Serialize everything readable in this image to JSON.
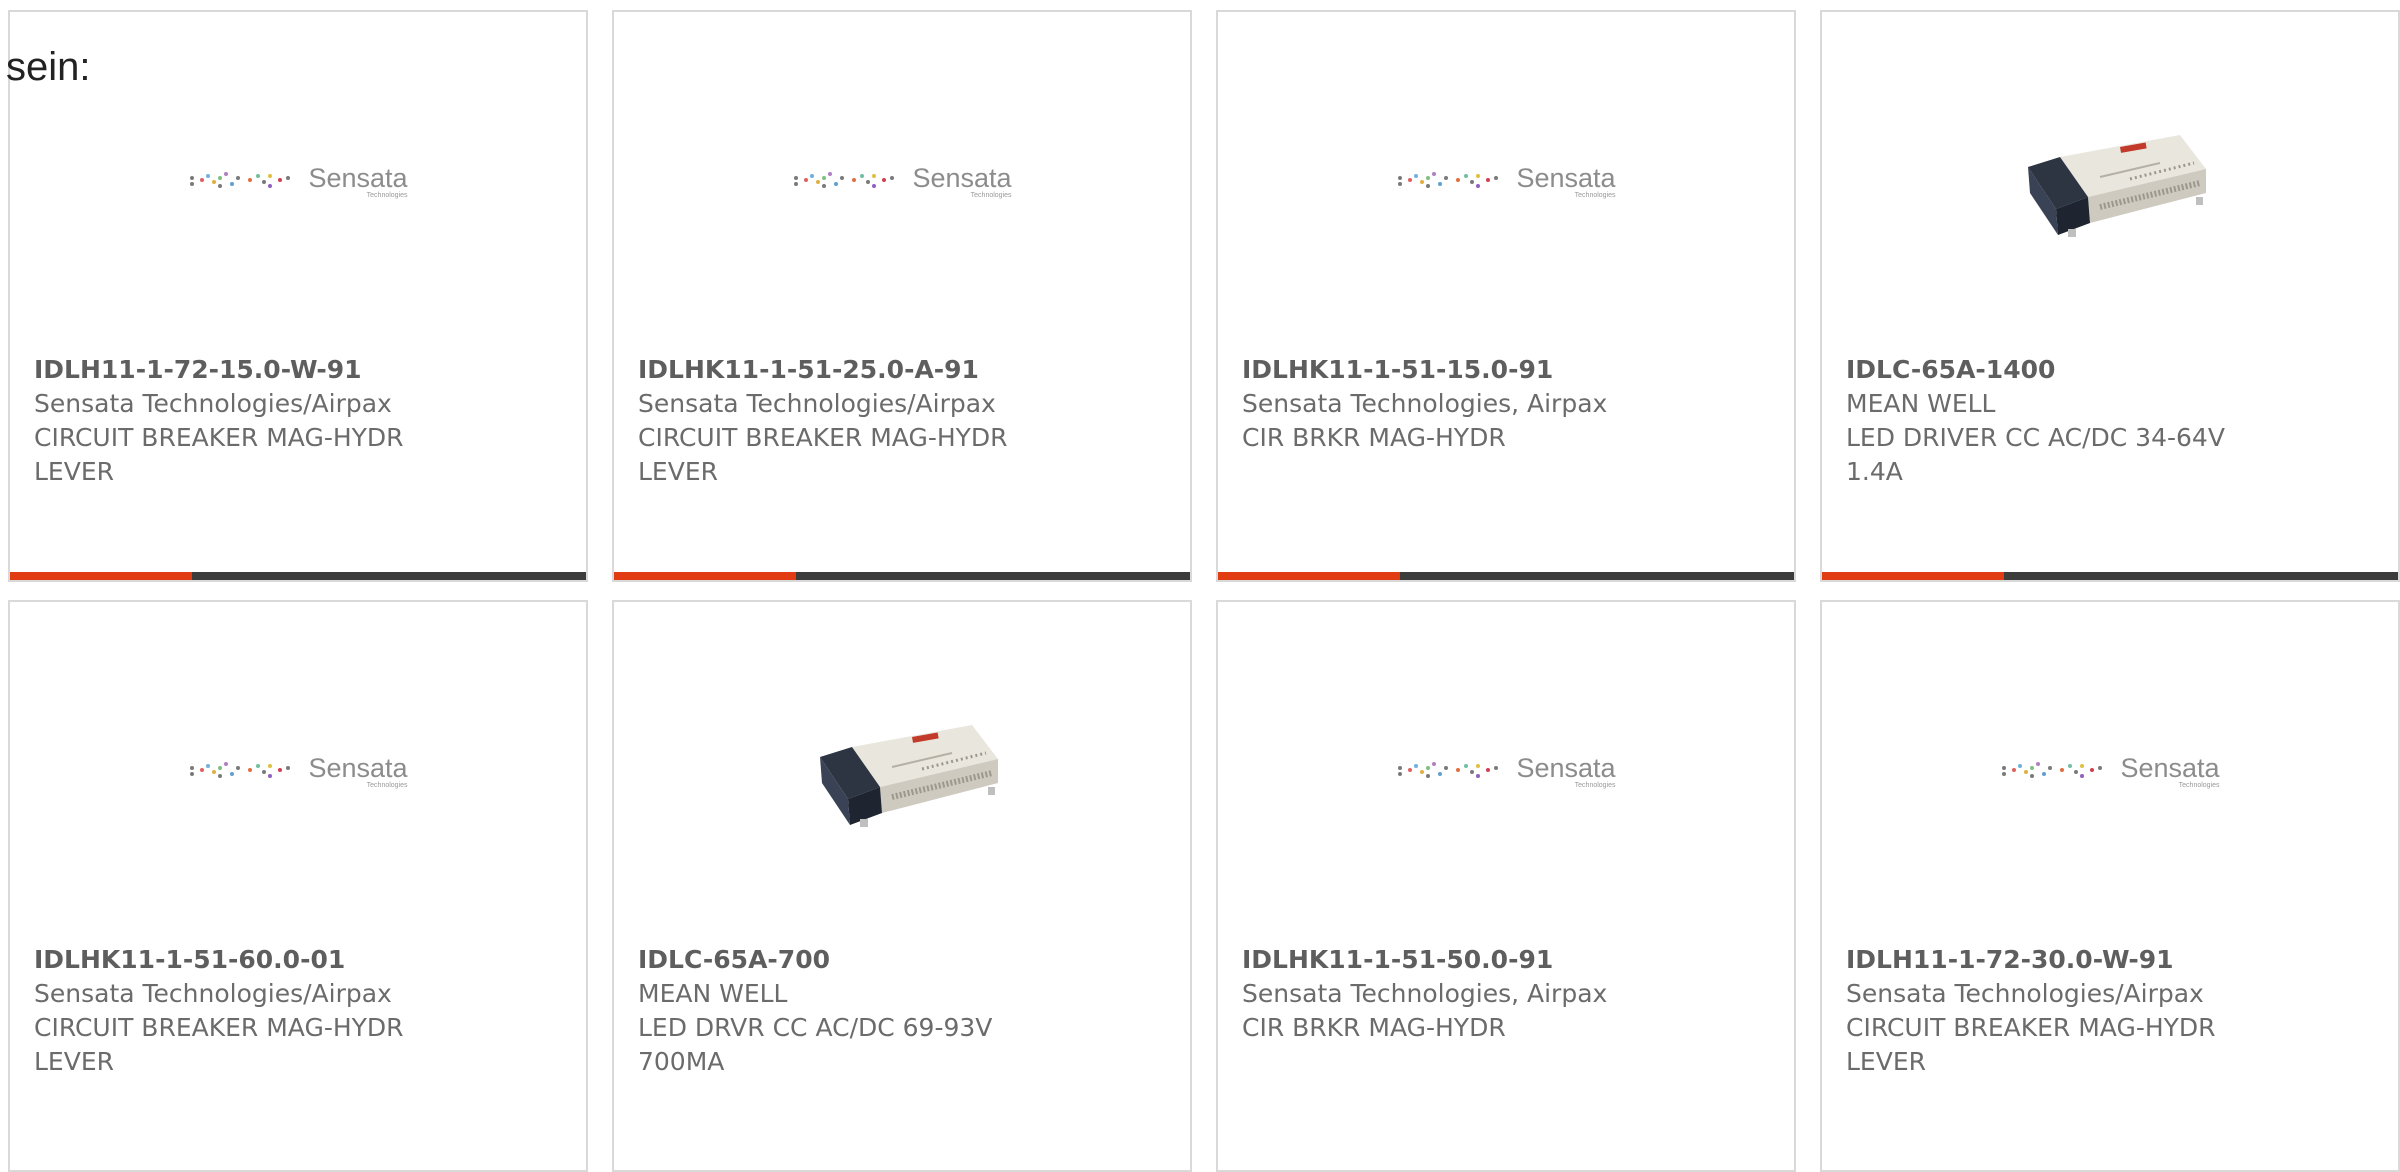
{
  "intro_text": "sein:",
  "logo": {
    "name": "Sensata",
    "sub": "Technologies"
  },
  "colors": {
    "accent": "#e23d12",
    "bar": "#3c3c3c",
    "border": "#d9d9d9",
    "text": "#6b6b6b"
  },
  "products": [
    {
      "part": "IDLH11-1-72-15.0-W-91",
      "maker": "Sensata Technologies/Airpax",
      "desc1": "CIRCUIT BREAKER MAG-HYDR",
      "desc2": "LEVER",
      "image": "sensata-logo"
    },
    {
      "part": "IDLHK11-1-51-25.0-A-91",
      "maker": "Sensata Technologies/Airpax",
      "desc1": "CIRCUIT BREAKER MAG-HYDR",
      "desc2": "LEVER",
      "image": "sensata-logo"
    },
    {
      "part": "IDLHK11-1-51-15.0-91",
      "maker": "Sensata Technologies, Airpax",
      "desc1": "CIR BRKR MAG-HYDR",
      "desc2": "",
      "image": "sensata-logo"
    },
    {
      "part": "IDLC-65A-1400",
      "maker": "MEAN WELL",
      "desc1": "LED DRIVER CC AC/DC 34-64V",
      "desc2": "1.4A",
      "image": "led-driver-photo"
    },
    {
      "part": "IDLHK11-1-51-60.0-01",
      "maker": "Sensata Technologies/Airpax",
      "desc1": "CIRCUIT BREAKER MAG-HYDR",
      "desc2": "LEVER",
      "image": "sensata-logo"
    },
    {
      "part": "IDLC-65A-700",
      "maker": "MEAN WELL",
      "desc1": "LED DRVR CC AC/DC 69-93V",
      "desc2": "700MA",
      "image": "led-driver-photo"
    },
    {
      "part": "IDLHK11-1-51-50.0-91",
      "maker": "Sensata Technologies, Airpax",
      "desc1": "CIR BRKR MAG-HYDR",
      "desc2": "",
      "image": "sensata-logo"
    },
    {
      "part": "IDLH11-1-72-30.0-W-91",
      "maker": "Sensata Technologies/Airpax",
      "desc1": "CIRCUIT BREAKER MAG-HYDR",
      "desc2": "LEVER",
      "image": "sensata-logo"
    }
  ]
}
